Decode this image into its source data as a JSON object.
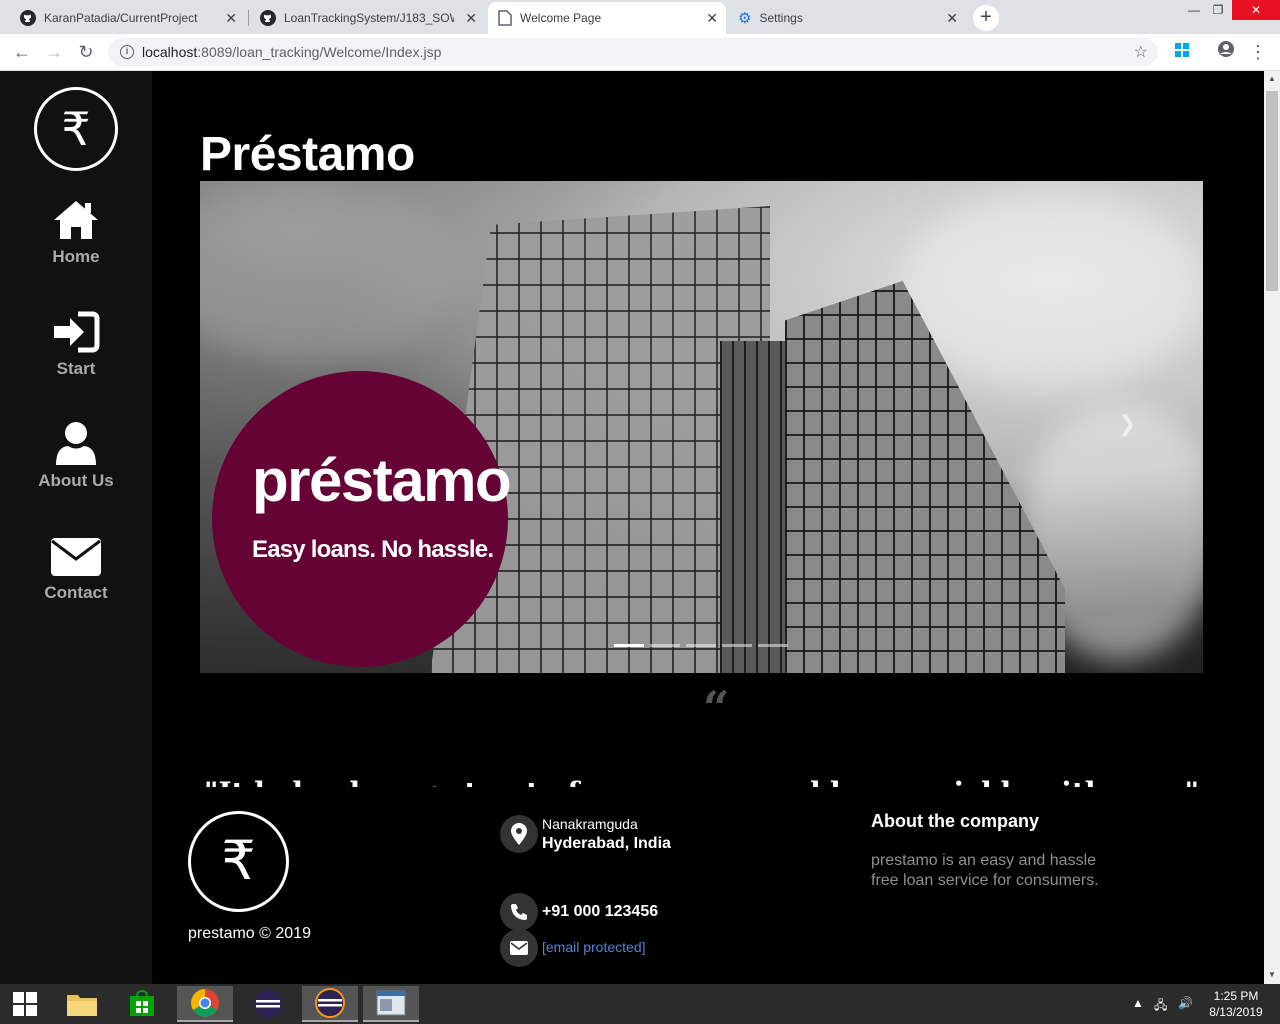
{
  "browser": {
    "tabs": [
      {
        "title": "KaranPatadia/CurrentProject",
        "icon": "github-icon",
        "active": false
      },
      {
        "title": "LoanTrackingSystem/J183_SOW",
        "icon": "github-icon",
        "active": false
      },
      {
        "title": "Welcome Page",
        "icon": "page-icon",
        "active": true
      },
      {
        "title": "Settings",
        "icon": "gear-icon",
        "active": false
      }
    ],
    "url_host": "localhost",
    "url_rest": ":8089/loan_tracking/Welcome/Index.jsp"
  },
  "sidebar": {
    "logo_symbol": "₹",
    "items": [
      {
        "label": "Home",
        "icon": "home-icon"
      },
      {
        "label": "Start",
        "icon": "sign-in-icon"
      },
      {
        "label": "About Us",
        "icon": "user-icon"
      },
      {
        "label": "Contact",
        "icon": "envelope-icon"
      }
    ]
  },
  "main": {
    "title": "Préstamo",
    "carousel": {
      "brand_name": "préstamo",
      "tagline": "Easy loans. No hassle.",
      "slide_count": 5,
      "active_slide": 1,
      "brand_color": "#650334"
    },
    "quote_mark": "“",
    "quote_text": "\"It helped me get out of my money problems quickly with ease\""
  },
  "footer": {
    "logo_symbol": "₹",
    "copyright": "prestamo © 2019",
    "address_line1": "Nanakramguda",
    "address_line2": "Hyderabad, India",
    "phone": "+91 000 123456",
    "email": "[email protected]",
    "about_title": "About the company",
    "about_text": "prestamo is an easy and hassle free loan service for consumers.",
    "link_color": "#5383d3"
  },
  "taskbar": {
    "time": "1:25 PM",
    "date": "8/13/2019"
  }
}
